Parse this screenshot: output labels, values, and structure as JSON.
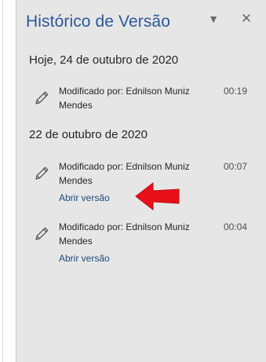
{
  "pane": {
    "title": "Histórico de Versão",
    "menu_glyph": "▼",
    "close_glyph": "✕"
  },
  "groups": [
    {
      "heading": "Hoje, 24 de outubro de 2020",
      "entries": [
        {
          "description": "Modificado por: Ednilson Muniz Mendes",
          "time": "00:19",
          "link": ""
        }
      ]
    },
    {
      "heading": "22 de outubro de 2020",
      "entries": [
        {
          "description": "Modificado por: Ednilson Muniz Mendes",
          "time": "00:07",
          "link": "Abrir versão"
        },
        {
          "description": "Modificado por: Ednilson Muniz Mendes",
          "time": "00:04",
          "link": "Abrir versão"
        }
      ]
    }
  ],
  "icons": {
    "entry_icon": "pencil-icon",
    "pointer": "red-arrow-icon"
  },
  "colors": {
    "title": "#2b579a",
    "link": "#1f497d",
    "pane_background": "#e6e6e6",
    "arrow": "#e8101a"
  }
}
